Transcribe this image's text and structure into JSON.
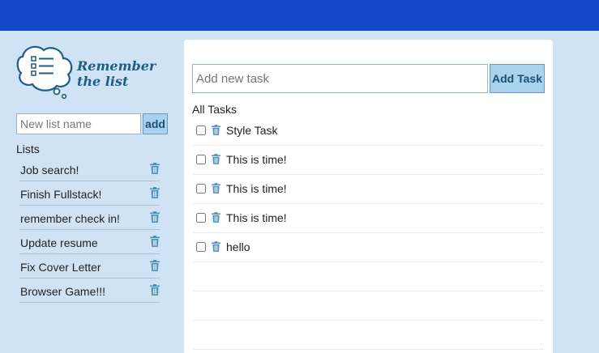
{
  "brand": {
    "line1": "Remember",
    "line2": "the list"
  },
  "sidebar": {
    "new_list_placeholder": "New list name",
    "add_label": "add",
    "lists_heading": "Lists",
    "lists": [
      {
        "label": "Job search!"
      },
      {
        "label": "Finish Fullstack!"
      },
      {
        "label": "remember check in!"
      },
      {
        "label": "Update resume"
      },
      {
        "label": "Fix Cover Letter"
      },
      {
        "label": "Browser Game!!!"
      }
    ]
  },
  "main": {
    "new_task_placeholder": "Add new task",
    "add_task_label": "Add Task",
    "tasks_heading": "All Tasks",
    "tasks": [
      {
        "text": "Style Task",
        "done": false
      },
      {
        "text": "This is time!",
        "done": false
      },
      {
        "text": "This is time!",
        "done": false
      },
      {
        "text": "This is time!",
        "done": false
      },
      {
        "text": "hello",
        "done": false
      },
      {
        "text": "",
        "done": false
      },
      {
        "text": "",
        "done": false
      },
      {
        "text": "",
        "done": false
      }
    ]
  },
  "colors": {
    "topbar": "#1447c8",
    "background": "#cfe3f5",
    "button": "#a9d2ef",
    "brand_text": "#1d5e82",
    "icon": "#4f90b8"
  },
  "icons": {
    "logo": "thought-bubble-checklist-icon",
    "delete": "trash-icon"
  }
}
